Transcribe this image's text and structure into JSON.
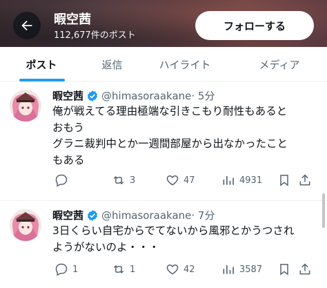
{
  "header": {
    "name": "暇空茜",
    "post_count": "112,677件のポスト",
    "follow_label": "フォローする"
  },
  "tabs": [
    {
      "label": "ポスト",
      "active": true
    },
    {
      "label": "返信",
      "active": false
    },
    {
      "label": "ハイライト",
      "active": false
    },
    {
      "label": "メディア",
      "active": false
    }
  ],
  "posts": [
    {
      "name": "暇空茜",
      "handle": "@himasoraakane",
      "time": "· 5分",
      "text_lines": [
        "俺が戦えてる理由極端な引きこもり耐性もあると",
        "おもう",
        "グラニ裁判中とか一週間部屋から出なかったこと",
        "もある"
      ],
      "replies": "",
      "reposts": "3",
      "likes": "47",
      "views": "4931"
    },
    {
      "name": "暇空茜",
      "handle": "@himasoraakane",
      "time": "· 7分",
      "text_lines": [
        "3日くらい自宅からでてないから風邪とかうつされ",
        "ようがないのよ・・・"
      ],
      "replies": "1",
      "reposts": "1",
      "likes": "42",
      "views": "3587"
    }
  ],
  "colors": {
    "accent": "#1d9bf0",
    "muted": "#536471",
    "text": "#0f1419"
  },
  "icons": [
    "back-arrow-icon",
    "verified-badge-icon",
    "reply-icon",
    "repost-icon",
    "like-icon",
    "views-icon",
    "bookmark-icon",
    "share-icon"
  ]
}
